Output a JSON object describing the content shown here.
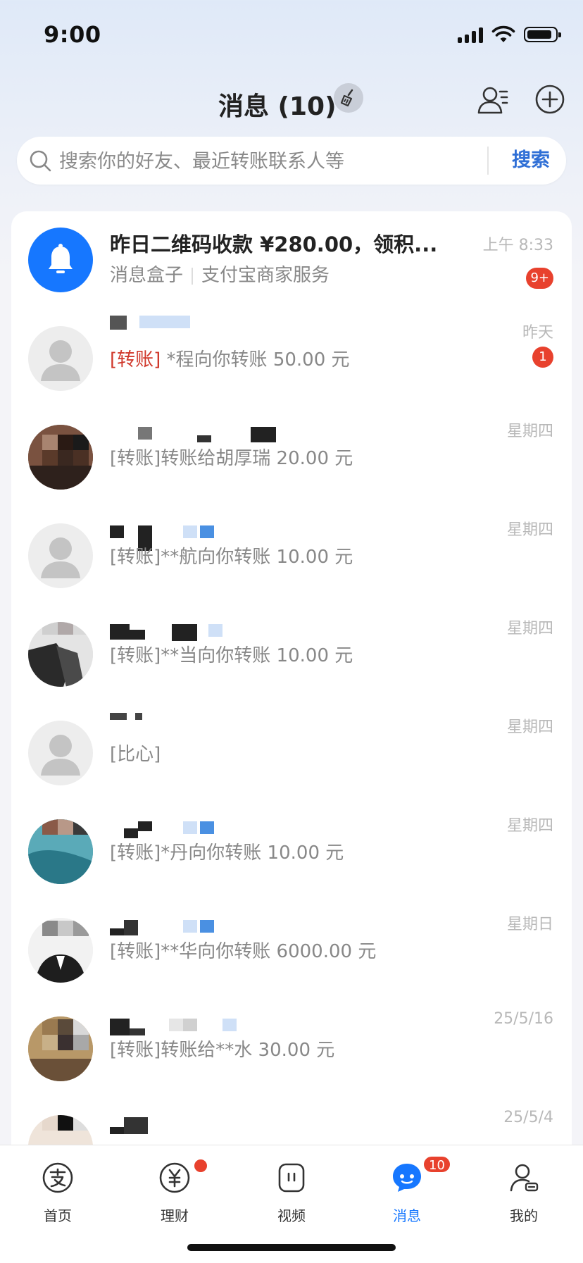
{
  "status_bar": {
    "time": "9:00",
    "battery_level": 0.9
  },
  "header": {
    "title": "消息 (10)"
  },
  "search": {
    "placeholder": "搜索你的好友、最近转账联系人等",
    "button_label": "搜索"
  },
  "conversations": [
    {
      "title": "昨日二维码收款 ¥280.00，领积...",
      "subtitle_a": "消息盒子",
      "subtitle_b": "支付宝商家服务",
      "time": "上午 8:33",
      "badge": "9+"
    },
    {
      "tag": "[转账]",
      "message": " *程向你转账 50.00 元",
      "time": "昨天",
      "badge": "1"
    },
    {
      "message": "[转账]转账给胡厚瑞 20.00 元",
      "time": "星期四"
    },
    {
      "message": "[转账]**航向你转账 10.00 元",
      "time": "星期四"
    },
    {
      "message": "[转账]**当向你转账 10.00 元",
      "time": "星期四"
    },
    {
      "message": "[比心]",
      "time": "星期四"
    },
    {
      "message": "[转账]*丹向你转账 10.00 元",
      "time": "星期四"
    },
    {
      "message": "[转账]**华向你转账 6000.00 元",
      "time": "星期日"
    },
    {
      "message": "[转账]转账给**水 30.00 元",
      "time": "25/5/16"
    },
    {
      "message": "",
      "time": "25/5/4"
    }
  ],
  "tabs": [
    {
      "label": "首页",
      "icon": "alipay-home-icon"
    },
    {
      "label": "理财",
      "icon": "wealth-icon",
      "dot": true
    },
    {
      "label": "视频",
      "icon": "video-icon"
    },
    {
      "label": "消息",
      "icon": "message-icon",
      "badge": "10",
      "active": true
    },
    {
      "label": "我的",
      "icon": "profile-icon"
    }
  ],
  "colors": {
    "accent": "#1677ff",
    "badge": "#e8412d",
    "transfer_tag": "#d0382b",
    "search_button": "#2f6fd6"
  }
}
